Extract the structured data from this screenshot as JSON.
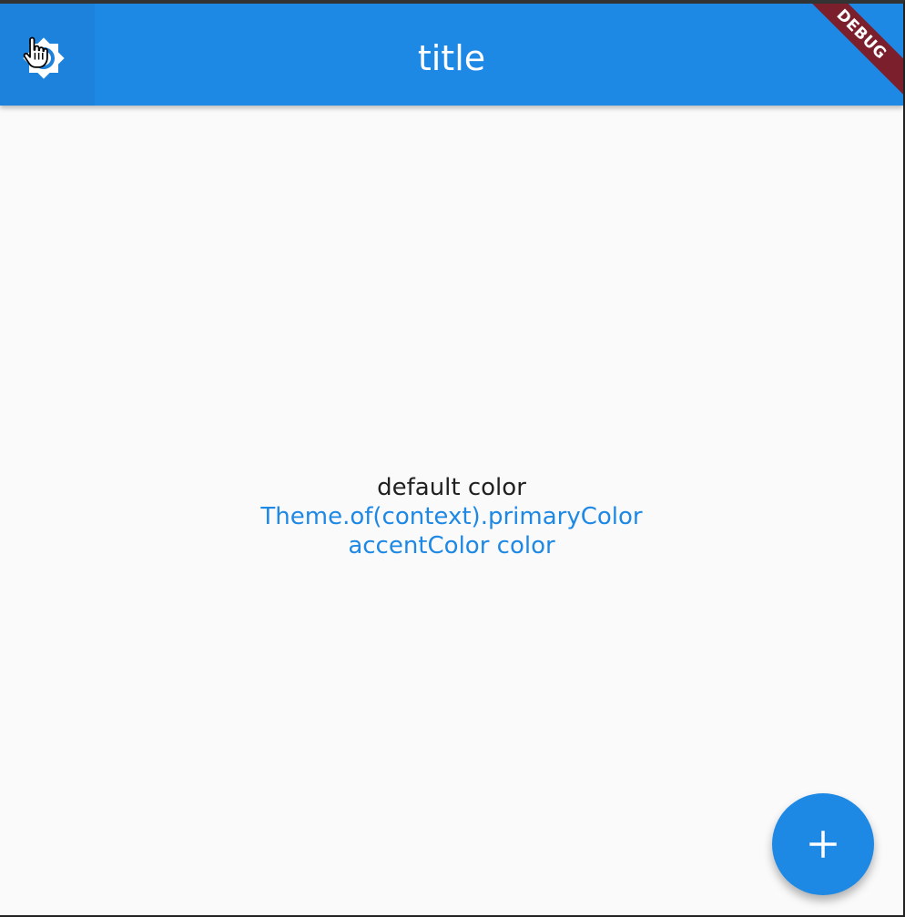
{
  "appbar": {
    "title": "title",
    "leading_icon": "brightness-settings-icon",
    "color": "#1e88e5"
  },
  "debug_banner": {
    "label": "DEBUG",
    "color": "#7a1f2b"
  },
  "body": {
    "lines": {
      "default": "default color",
      "primary": "Theme.of(context).primaryColor",
      "accent": "accentColor color"
    },
    "colors": {
      "default": "#212121",
      "primary": "#1e88e5",
      "accent": "#1e88e5"
    }
  },
  "fab": {
    "icon": "add-icon",
    "color": "#1e88e5"
  }
}
